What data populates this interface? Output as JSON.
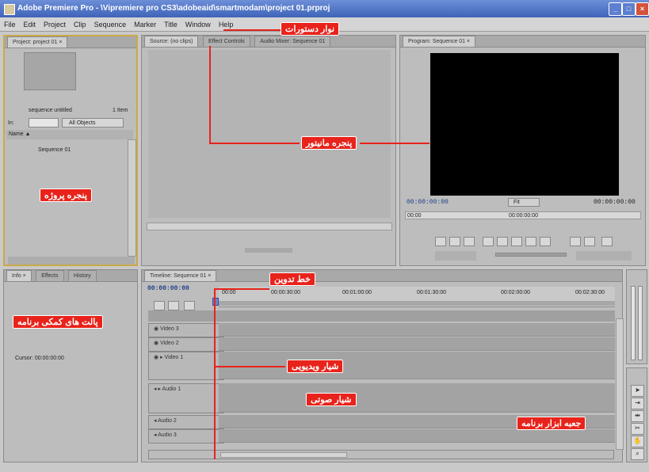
{
  "window": {
    "title": "Adobe Premiere Pro - \\Vipremiere pro CS3\\adobeaid\\smartmodam\\project 01.prproj",
    "controls": {
      "minimize": "_",
      "maximize": "□",
      "close": "×"
    }
  },
  "menu": [
    "File",
    "Edit",
    "Project",
    "Clip",
    "Sequence",
    "Marker",
    "Title",
    "Window",
    "Help"
  ],
  "project_panel": {
    "tab": "Project: project 01 ×",
    "item_name": "sequence untitled",
    "item_count": "1 Item",
    "in_label": "In:",
    "in_value": "All Objects",
    "list_header": "Name",
    "sequence_item": "Sequence 01"
  },
  "source_monitor": {
    "tabs": [
      "Source: (no clips)",
      "Effect Controls",
      "Audio Mixer: Sequence 01"
    ]
  },
  "program_monitor": {
    "tab": "Program: Sequence 01 ×",
    "timecode_left": "00:00:00:00",
    "fit": "Fit",
    "timecode_right": "00:00:00:00",
    "ruler_left": "00:00",
    "ruler_mid": "00:00:00:00"
  },
  "info_panel": {
    "tabs": [
      "Info ×",
      "Effects",
      "History"
    ],
    "cursor_text": "Cursor: 00:00:00:00"
  },
  "timeline": {
    "tab": "Timeline: Sequence 01 ×",
    "current_time": "00:00:00:00",
    "ruler_marks": [
      "00:00",
      "00:00:30:00",
      "00:01:00:00",
      "00:01:30:00",
      "00:02:00:00",
      "00:02:30:00"
    ],
    "tracks": [
      "Video 3",
      "Video 2",
      "Video 1",
      "Audio 1",
      "Audio 2",
      "Audio 3"
    ]
  },
  "annotations": {
    "menu_bar": "نوار دستورات",
    "monitor_window": "پنجره مانیتور",
    "project_window": "پنجره پروژه",
    "edit_line": "خط تدوین",
    "help_palettes": "پالت های کمکی برنامه",
    "video_track": "شیار ویدیویی",
    "audio_track": "شیار صوتی",
    "toolbox": "جعبه ابزار برنامه"
  },
  "colors": {
    "annotation_red": "#e8231b",
    "title_blue": "#3f64b8",
    "monitor_black": "#000000"
  }
}
